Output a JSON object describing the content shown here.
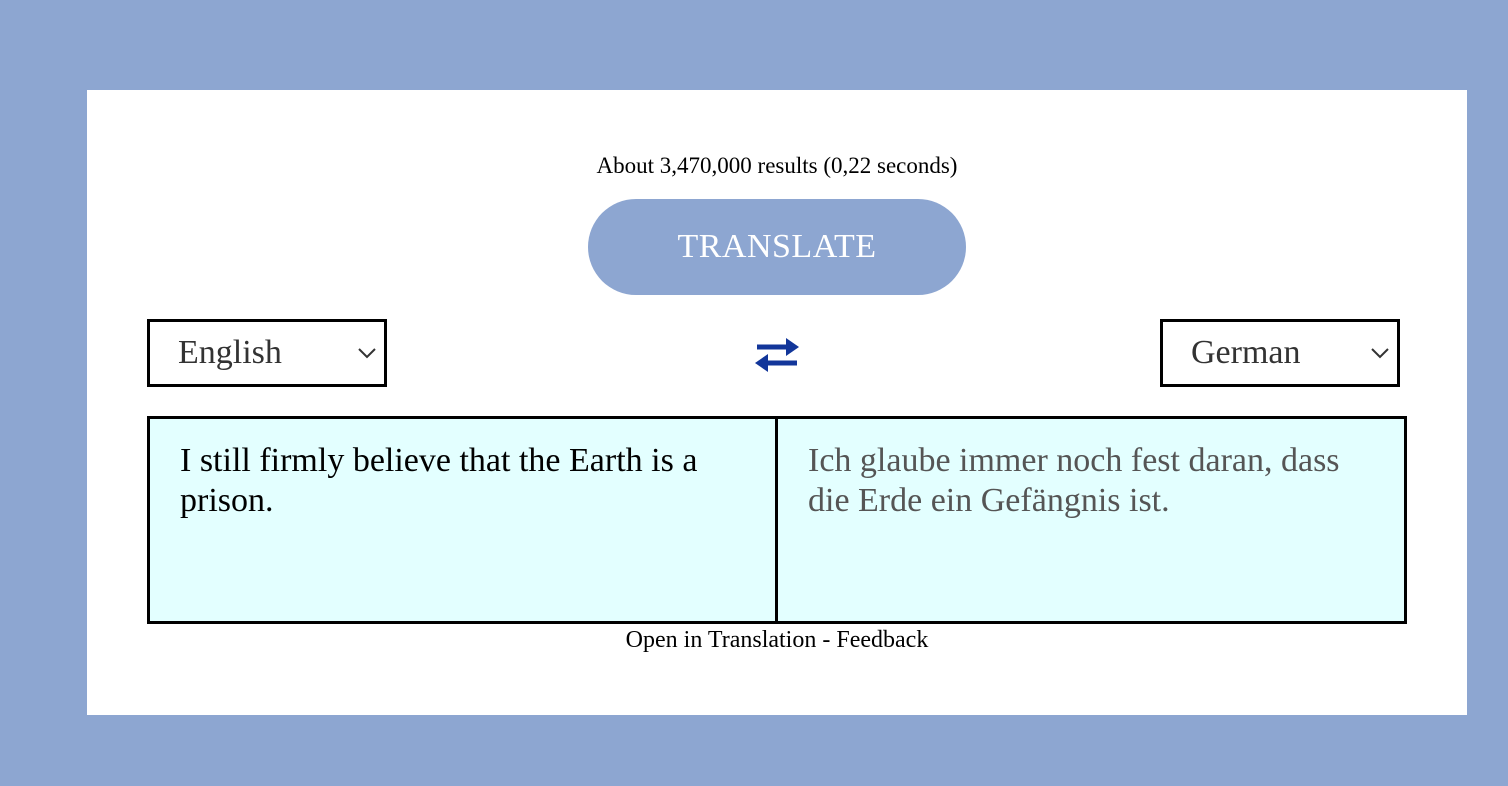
{
  "results_text": "About 3,470,000 results (0,22 seconds)",
  "translate_button": "TRANSLATE",
  "source_language": {
    "selected": "English"
  },
  "target_language": {
    "selected": "German"
  },
  "source_text": "I still firmly believe that the Earth is a prison.",
  "translated_text": "Ich glaube immer noch fest daran, dass die Erde ein Gefängnis ist.",
  "footer": {
    "open_link": "Open in Translation",
    "separator": " - ",
    "feedback_link": "Feedback"
  },
  "icons": {
    "swap": "swap-arrows-icon",
    "chevron": "chevron-down-icon"
  },
  "colors": {
    "background": "#8da6d1",
    "card": "#ffffff",
    "button": "#8da6d1",
    "panel": "#e3ffff",
    "swap_icon": "#12369a"
  }
}
